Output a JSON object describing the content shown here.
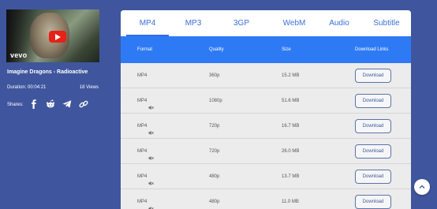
{
  "video": {
    "title": "Imagine Dragons - Radioactive",
    "duration": "Duration: 00:04:21",
    "views": "18 Views",
    "thumbnail_logo": "vevo",
    "shares_label": "Shares:",
    "share_icons": [
      "facebook-icon",
      "reddit-icon",
      "telegram-icon",
      "link-icon"
    ]
  },
  "tabs": [
    {
      "label": "MP4",
      "active": true
    },
    {
      "label": "MP3",
      "active": false
    },
    {
      "label": "3GP",
      "active": false
    },
    {
      "label": "WebM",
      "active": false
    },
    {
      "label": "Audio",
      "active": false
    },
    {
      "label": "Subtitle",
      "active": false
    }
  ],
  "table": {
    "headers": {
      "format": "Format",
      "quality": "Quality",
      "size": "Size",
      "links": "Download Links"
    },
    "rows": [
      {
        "format": "MP4",
        "muted": false,
        "quality": "360p",
        "size": "15.2 MB",
        "button": "Download"
      },
      {
        "format": "MP4",
        "muted": true,
        "quality": "1080p",
        "size": "51.6 MB",
        "button": "Download"
      },
      {
        "format": "MP4",
        "muted": true,
        "quality": "720p",
        "size": "16.7 MB",
        "button": "Download"
      },
      {
        "format": "MP4",
        "muted": true,
        "quality": "720p",
        "size": "26.0 MB",
        "button": "Download"
      },
      {
        "format": "MP4",
        "muted": true,
        "quality": "480p",
        "size": "13.7 MB",
        "button": "Download"
      },
      {
        "format": "MP4",
        "muted": true,
        "quality": "480p",
        "size": "11.0 MB",
        "button": "Download"
      }
    ]
  },
  "colors": {
    "background": "#3f569e",
    "accent": "#2e7af5",
    "tab_text": "#3b6fd8"
  }
}
